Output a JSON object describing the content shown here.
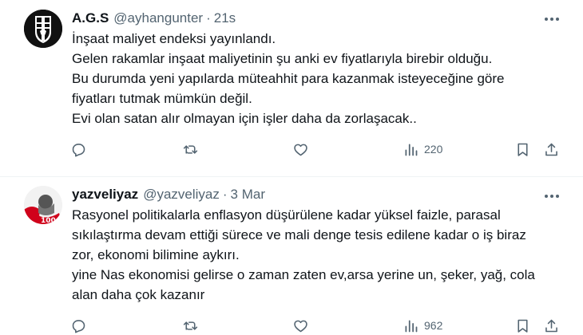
{
  "tweets": [
    {
      "name": "A.G.S",
      "handle": "@ayhangunter",
      "separator": "·",
      "time": "21s",
      "lines": [
        "İnşaat maliyet endeksi yayınlandı.",
        "Gelen rakamlar inşaat maliyetinin şu anki ev fiyatlarıyla birebir olduğu.",
        "Bu durumda yeni yapılarda müteahhit para kazanmak isteyeceğine göre",
        "fiyatları tutmak mümkün değil.",
        "Evi olan satan alır olmayan için işler daha da zorlaşacak.."
      ],
      "views": "220"
    },
    {
      "name": "yazveliyaz",
      "handle": "@yazveliyaz",
      "separator": "·",
      "time": "3 Mar",
      "lines": [
        "Rasyonel politikalarla enflasyon düşürülene kadar yüksel faizle, parasal",
        "sıkılaştırma devam ettiği sürece ve mali denge tesis edilene kadar o iş biraz",
        "zor, ekonomi bilimine aykırı.",
        "yine Nas ekonomisi gelirse o zaman zaten ev,arsa yerine un, şeker, yağ, cola",
        "alan daha çok kazanır"
      ],
      "views": "962"
    }
  ],
  "colors": {
    "text": "#0f1419",
    "secondary": "#536471",
    "divider": "#eff3f4",
    "avatar_red": "#d0021b"
  },
  "icons": [
    "more-icon",
    "reply-icon",
    "retweet-icon",
    "like-icon",
    "views-icon",
    "bookmark-icon",
    "share-icon"
  ]
}
